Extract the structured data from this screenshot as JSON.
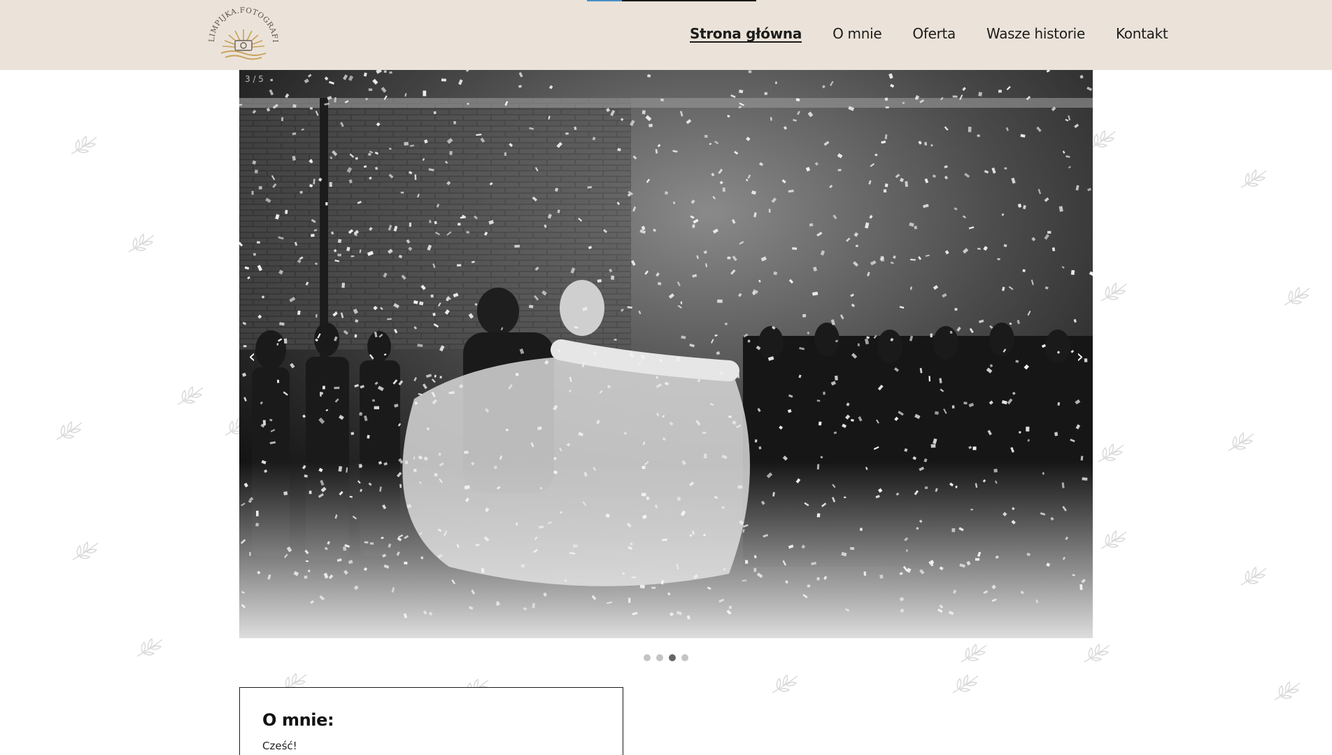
{
  "brand": {
    "name": "OLIMPIJKA.FOTOGRAFIE",
    "accent": "#c9a15a"
  },
  "colors": {
    "header_bg": "#ebe3d9",
    "text": "#1c1c1c",
    "leaf": "#b9b9b9"
  },
  "nav": {
    "items": [
      {
        "label": "Strona główna",
        "active": true
      },
      {
        "label": "O mnie"
      },
      {
        "label": "Oferta"
      },
      {
        "label": "Wasze historie"
      },
      {
        "label": "Kontakt"
      }
    ]
  },
  "slider": {
    "counter": "3 / 5",
    "prev_icon": "chevron-left-icon",
    "next_icon": "chevron-right-icon",
    "prev_glyph": "‹",
    "next_glyph": "›",
    "photo_alt": "Black and white photo of a couple's first dance under falling confetti",
    "dots": 4,
    "active_dot": 3
  },
  "about": {
    "heading": "O mnie:",
    "text": "Cześć!"
  }
}
